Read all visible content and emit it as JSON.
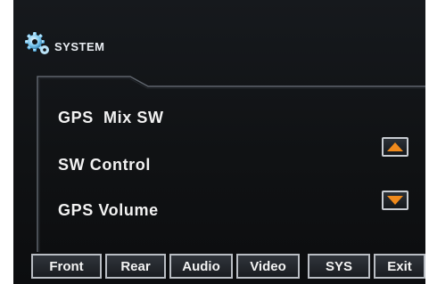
{
  "header": {
    "title": "SYSTEM",
    "icon": "gear-icon"
  },
  "menu": {
    "items": [
      {
        "label": "GPS  Mix SW"
      },
      {
        "label": "SW Control"
      },
      {
        "label": "GPS Volume"
      }
    ]
  },
  "scroll": {
    "up_icon": "arrow-up-icon",
    "down_icon": "arrow-down-icon"
  },
  "tabs": [
    {
      "label": "Front"
    },
    {
      "label": "Rear"
    },
    {
      "label": "Audio"
    },
    {
      "label": "Video"
    },
    {
      "label": "SYS"
    },
    {
      "label": "Exit"
    }
  ],
  "colors": {
    "background": "#101214",
    "text": "#f2f2f2",
    "arrow_fill": "#f08a1c",
    "border": "#b9bdc3"
  }
}
